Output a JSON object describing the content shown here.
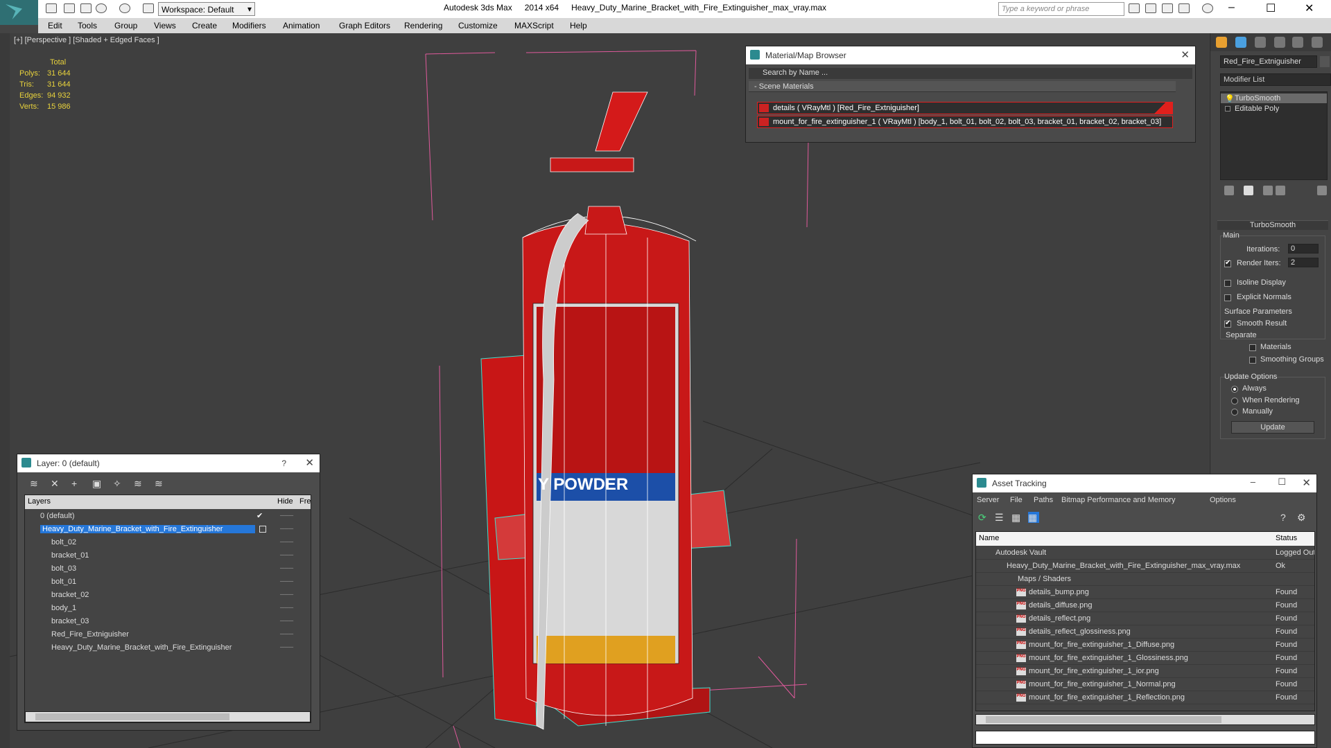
{
  "app": {
    "workspace_label": "Workspace: Default",
    "app_name": "Autodesk 3ds Max",
    "version": "2014 x64",
    "file_name": "Heavy_Duty_Marine_Bracket_with_Fire_Extinguisher_max_vray.max",
    "search_placeholder": "Type a keyword or phrase"
  },
  "menu": [
    "Edit",
    "Tools",
    "Group",
    "Views",
    "Create",
    "Modifiers",
    "Animation",
    "Graph Editors",
    "Rendering",
    "Customize",
    "MAXScript",
    "Help"
  ],
  "viewport": {
    "label": "[+] [Perspective ] [Shaded + Edged Faces ]",
    "stats": {
      "header": "Total",
      "rows": [
        {
          "label": "Polys:",
          "value": "31 644"
        },
        {
          "label": "Tris:",
          "value": "31 644"
        },
        {
          "label": "Edges:",
          "value": "94 932"
        },
        {
          "label": "Verts:",
          "value": "15 986"
        }
      ]
    },
    "decal_text": "Y POWDER"
  },
  "material_browser": {
    "title": "Material/Map Browser",
    "search_placeholder": "Search by Name ...",
    "section": "- Scene Materials",
    "materials": [
      "details  ( VRayMtl )  [Red_Fire_Extniguisher]",
      "mount_for_fire_extinguisher_1  ( VRayMtl )  [body_1, bolt_01, bolt_02, bolt_03, bracket_01, bracket_02, bracket_03]"
    ]
  },
  "command_panel": {
    "object_name": "Red_Fire_Extniguisher",
    "modifier_list": "Modifier List",
    "stack": [
      "TurboSmooth",
      "Editable Poly"
    ],
    "rollout_title": "TurboSmooth",
    "main_group": "Main",
    "iterations_label": "Iterations:",
    "iterations_value": "0",
    "render_iters_label": "Render Iters:",
    "render_iters_value": "2",
    "render_iters_checked": true,
    "isoline_label": "Isoline Display",
    "explicit_normals_label": "Explicit Normals",
    "surface_group": "Surface Parameters",
    "smooth_result_label": "Smooth Result",
    "separate_label": "Separate",
    "materials_label": "Materials",
    "smoothing_groups_label": "Smoothing Groups",
    "update_group": "Update Options",
    "update_options": [
      "Always",
      "When Rendering",
      "Manually"
    ],
    "update_button": "Update"
  },
  "layer_window": {
    "title": "Layer: 0 (default)",
    "help": "?",
    "col_layers": "Layers",
    "col_hide": "Hide",
    "col_freeze": "Fre",
    "rows": [
      {
        "name": "0 (default)",
        "level": 0
      },
      {
        "name": "Heavy_Duty_Marine_Bracket_with_Fire_Extinguisher",
        "level": 0,
        "selected": true
      },
      {
        "name": "bolt_02",
        "level": 1
      },
      {
        "name": "bracket_01",
        "level": 1
      },
      {
        "name": "bolt_03",
        "level": 1
      },
      {
        "name": "bolt_01",
        "level": 1
      },
      {
        "name": "bracket_02",
        "level": 1
      },
      {
        "name": "body_1",
        "level": 1
      },
      {
        "name": "bracket_03",
        "level": 1
      },
      {
        "name": "Red_Fire_Extniguisher",
        "level": 1
      },
      {
        "name": "Heavy_Duty_Marine_Bracket_with_Fire_Extinguisher",
        "level": 1
      }
    ]
  },
  "asset_tracking": {
    "title": "Asset Tracking",
    "menu": [
      "Server",
      "File",
      "Paths",
      "Bitmap Performance and Memory",
      "Options"
    ],
    "col_name": "Name",
    "col_status": "Status",
    "rows": [
      {
        "name": "Autodesk Vault",
        "status": "Logged Out",
        "level": 0
      },
      {
        "name": "Heavy_Duty_Marine_Bracket_with_Fire_Extinguisher_max_vray.max",
        "status": "Ok",
        "level": 1
      },
      {
        "name": "Maps / Shaders",
        "status": "",
        "level": 2
      },
      {
        "name": "details_bump.png",
        "status": "Found",
        "level": 3
      },
      {
        "name": "details_diffuse.png",
        "status": "Found",
        "level": 3
      },
      {
        "name": "details_reflect.png",
        "status": "Found",
        "level": 3
      },
      {
        "name": "details_reflect_glossiness.png",
        "status": "Found",
        "level": 3
      },
      {
        "name": "mount_for_fire_extinguisher_1_Diffuse.png",
        "status": "Found",
        "level": 3
      },
      {
        "name": "mount_for_fire_extinguisher_1_Glossiness.png",
        "status": "Found",
        "level": 3
      },
      {
        "name": "mount_for_fire_extinguisher_1_ior.png",
        "status": "Found",
        "level": 3
      },
      {
        "name": "mount_for_fire_extinguisher_1_Normal.png",
        "status": "Found",
        "level": 3
      },
      {
        "name": "mount_for_fire_extinguisher_1_Reflection.png",
        "status": "Found",
        "level": 3
      }
    ]
  },
  "colors": {
    "accent": "#2577d9",
    "stats": "#e8d23c",
    "extinguisher_red": "#d41a1a",
    "wire_cyan": "#40e0d0"
  }
}
